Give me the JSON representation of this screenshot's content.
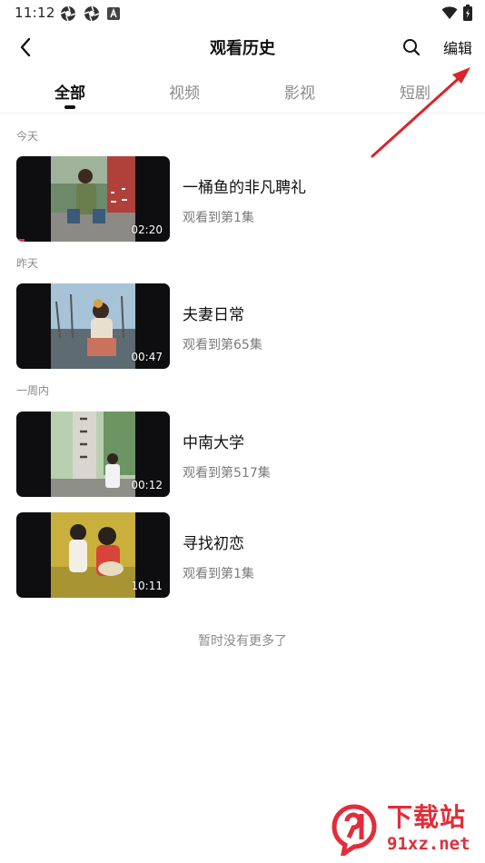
{
  "status_bar": {
    "time": "11:12",
    "icons": [
      "aperture-icon",
      "aperture-icon",
      "notification-a-icon"
    ],
    "right_icons": [
      "wifi-icon",
      "battery-charging-icon"
    ]
  },
  "header": {
    "title": "观看历史",
    "edit_label": "编辑",
    "back_icon": "chevron-left-icon",
    "search_icon": "search-icon"
  },
  "tabs": [
    {
      "label": "全部",
      "active": true
    },
    {
      "label": "视频",
      "active": false
    },
    {
      "label": "影视",
      "active": false
    },
    {
      "label": "短剧",
      "active": false
    }
  ],
  "sections": [
    {
      "label": "今天"
    },
    {
      "label": "昨天"
    },
    {
      "label": "一周内"
    }
  ],
  "items": [
    {
      "title": "一桶鱼的非凡聘礼",
      "progress_text": "观看到第1集",
      "duration": "02:20",
      "progress": 0.05
    },
    {
      "title": "夫妻日常",
      "progress_text": "观看到第65集",
      "duration": "00:47",
      "progress": 0
    },
    {
      "title": "中南大学",
      "progress_text": "观看到第517集",
      "duration": "00:12",
      "progress": 0
    },
    {
      "title": "寻找初恋",
      "progress_text": "观看到第1集",
      "duration": "10:11",
      "progress": 0
    }
  ],
  "end_text": "暂时没有更多了",
  "watermark": {
    "title": "下载站",
    "url": "91xz.net"
  },
  "colors": {
    "accent_red": "#e8304a",
    "arrow_red": "#d9252b",
    "text_primary": "#111111",
    "text_secondary": "#8a8a8a"
  }
}
